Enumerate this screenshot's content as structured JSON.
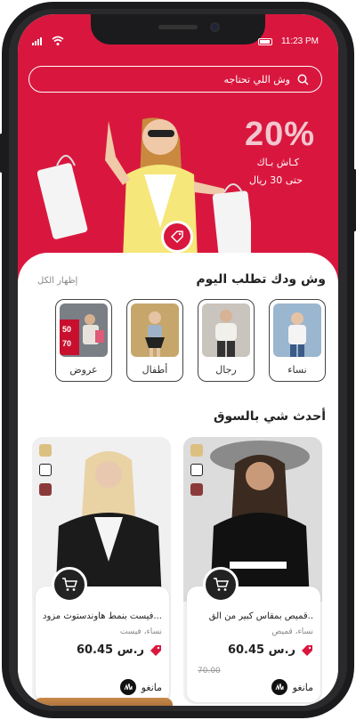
{
  "status_bar": {
    "time": "11:23 PM"
  },
  "search": {
    "placeholder": "وش اللي تحتاجه"
  },
  "promo": {
    "discount": "20%",
    "line1": "كـاش بـاك",
    "line2": "حتى 30 ريال"
  },
  "today": {
    "title": "وش ودك تطلب اليوم",
    "show_all": "إظهار الكل",
    "categories": [
      {
        "label": "نساء"
      },
      {
        "label": "رجال"
      },
      {
        "label": "أطفال"
      },
      {
        "label": "عروض",
        "poster_text": [
          "50",
          "70"
        ]
      }
    ]
  },
  "latest": {
    "title": "أحدث شي بالسوق",
    "products": [
      {
        "name": "قميص بمقاس كبير من الق..",
        "category": "نساء، قميص",
        "price": "60.45 ر.س",
        "old_price": "70.00",
        "brand": "مانغو",
        "swatches": [
          "#dcc082",
          "#ffffff",
          "#8b3a3a"
        ]
      },
      {
        "name": "فيست بنمط هاوندستوث مزود...",
        "category": "نساء، فيست",
        "price": "60.45 ر.س",
        "brand": "مانغو",
        "swatches": [
          "#dcc082",
          "#ffffff",
          "#8b3a3a"
        ]
      }
    ]
  },
  "colors": {
    "brand_red": "#d9173e",
    "dark": "#222222"
  },
  "icons": [
    "search-icon",
    "cart-icon",
    "tag-icon",
    "discount-tag-icon",
    "brand-logo-icon"
  ]
}
